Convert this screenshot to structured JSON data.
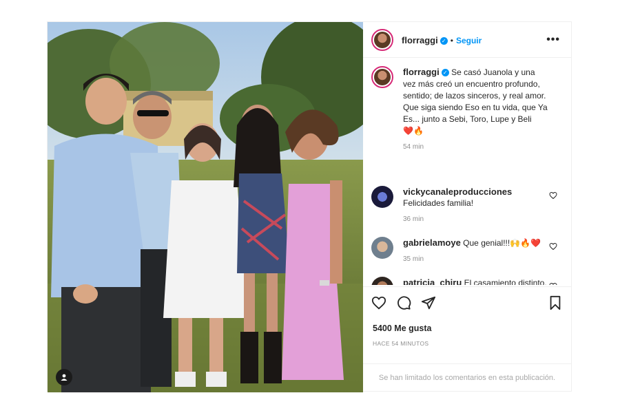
{
  "post": {
    "username": "florraggi",
    "follow_label": "Seguir",
    "more_label": "•••",
    "caption": {
      "username": "florraggi",
      "text": "Se casó Juanola y una vez más creó un encuentro profundo, sentido; de lazos sinceros, y real amor. Que siga siendo Eso en tu vida, que Ya Es... junto a Sebi, Toro, Lupe y Beli",
      "emoji": "❤️🔥",
      "time": "54 min"
    },
    "comments": [
      {
        "username": "vickycanaleproducciones",
        "text": "Felicidades familia!",
        "time": "36 min"
      },
      {
        "username": "gabrielamoye",
        "text": "Que genial!!!🙌🔥❤️",
        "time": "35 min"
      },
      {
        "username": "patricia_chiru",
        "text": "El casamiento distinto. Como ellos. Simpleza y paquetería ❤️",
        "time": ""
      }
    ],
    "likes": "5400 Me gusta",
    "posted": "HACE 54 MINUTOS",
    "comments_limited": "Se han limitado los comentarios en esta publicación."
  },
  "colors": {
    "verified": "#0095f6",
    "follow": "#0095f6",
    "story_ring": "#d62976",
    "muted": "#8e8e8e"
  },
  "icons": [
    "verified-badge-icon",
    "more-options-icon",
    "heart-icon",
    "comment-icon",
    "share-icon",
    "bookmark-icon",
    "tag-user-icon"
  ]
}
